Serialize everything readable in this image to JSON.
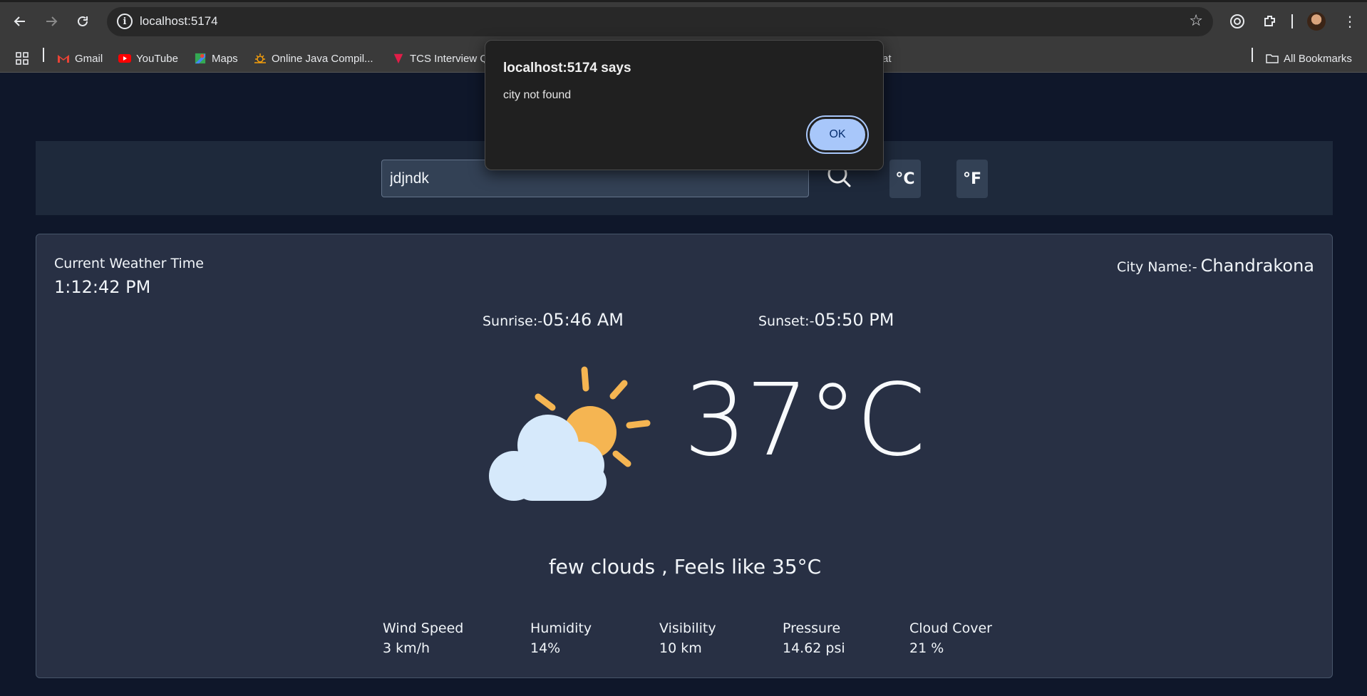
{
  "browser": {
    "url": "localhost:5174",
    "bookmarks": [
      {
        "label": "Gmail",
        "icon": "gmail-icon"
      },
      {
        "label": "YouTube",
        "icon": "youtube-icon"
      },
      {
        "label": "Maps",
        "icon": "maps-icon"
      },
      {
        "label": "Online Java Compil...",
        "icon": "compiler-icon"
      },
      {
        "label": "TCS Interview Q",
        "icon": "tcs-icon"
      },
      {
        "label": "at",
        "icon": "bookmark-icon"
      }
    ],
    "all_bookmarks": "All Bookmarks"
  },
  "search": {
    "value": "jdjndk",
    "celsius_label": "°C",
    "fahrenheit_label": "°F"
  },
  "weather": {
    "time_label": "Current Weather Time",
    "time_value": "1:12:42 PM",
    "city_label": "City Name:-",
    "city_value": "Chandrakona",
    "sunrise_label": "Sunrise:-",
    "sunrise_value": "05:46 AM",
    "sunset_label": "Sunset:-",
    "sunset_value": "05:50 PM",
    "icon": "partly-cloudy-icon",
    "temperature": "37°C",
    "description": "few clouds , Feels like 35°C",
    "stats": [
      {
        "label": "Wind Speed",
        "value": "3 km/h"
      },
      {
        "label": "Humidity",
        "value": "14%"
      },
      {
        "label": "Visibility",
        "value": "10 km"
      },
      {
        "label": "Pressure",
        "value": "14.62 psi"
      },
      {
        "label": "Cloud Cover",
        "value": "21 %"
      }
    ]
  },
  "alert": {
    "title": "localhost:5174 says",
    "message": "city not found",
    "ok_label": "OK"
  },
  "colors": {
    "page_bg": "#0f172a",
    "band_bg": "#1e293b",
    "card_bg": "#283044",
    "alert_button": "#a8c7fa"
  }
}
